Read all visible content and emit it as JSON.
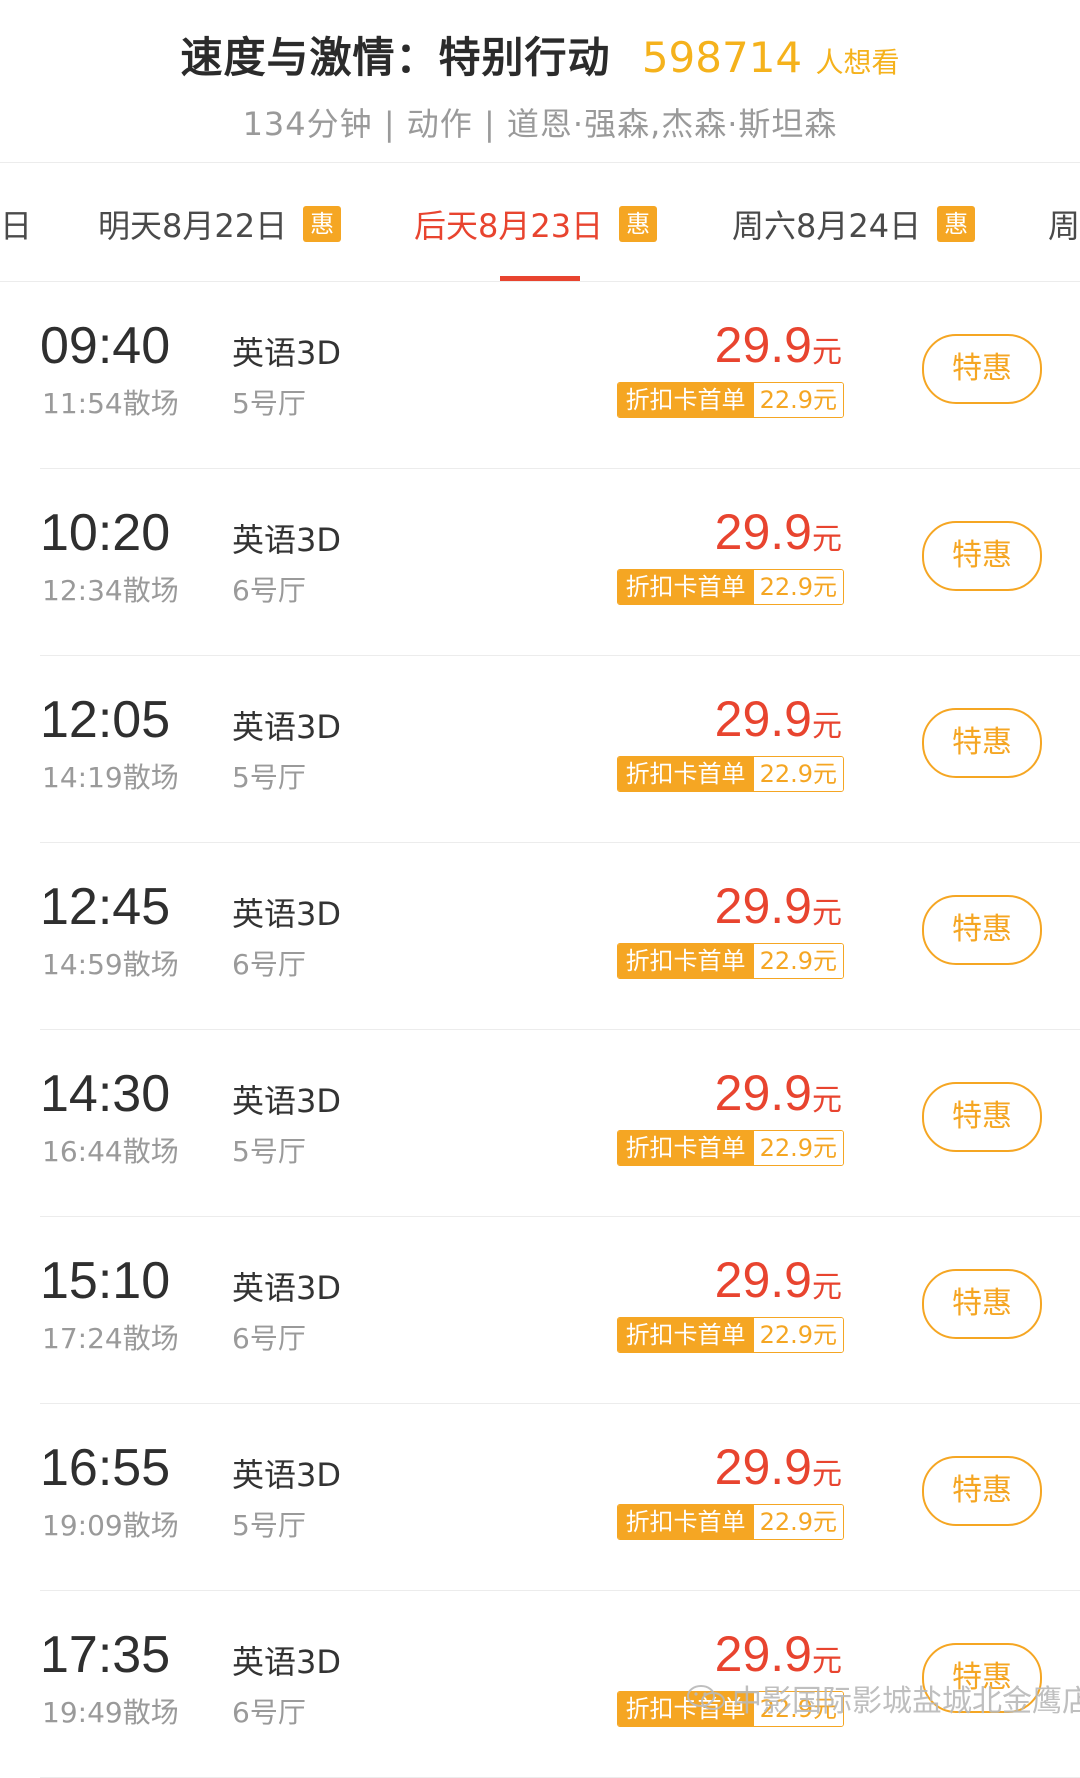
{
  "movie": {
    "title": "速度与激情：特别行动",
    "want_count": "598714",
    "want_label": "人想看",
    "info": "134分钟 | 动作 | 道恩·强森,杰森·斯坦森"
  },
  "date_tabs": [
    {
      "label": "日",
      "badge": ""
    },
    {
      "label": "明天8月22日",
      "badge": "惠"
    },
    {
      "label": "后天8月23日",
      "badge": "惠",
      "active": true
    },
    {
      "label": "周六8月24日",
      "badge": "惠"
    },
    {
      "label": "周",
      "badge": ""
    }
  ],
  "showtimes": [
    {
      "start": "09:40",
      "end": "11:54散场",
      "lang": "英语3D",
      "hall": "5号厅",
      "price": "29.9",
      "unit": "元",
      "card_label": "折扣卡首单",
      "card_price": "22.9元",
      "button": "特惠"
    },
    {
      "start": "10:20",
      "end": "12:34散场",
      "lang": "英语3D",
      "hall": "6号厅",
      "price": "29.9",
      "unit": "元",
      "card_label": "折扣卡首单",
      "card_price": "22.9元",
      "button": "特惠"
    },
    {
      "start": "12:05",
      "end": "14:19散场",
      "lang": "英语3D",
      "hall": "5号厅",
      "price": "29.9",
      "unit": "元",
      "card_label": "折扣卡首单",
      "card_price": "22.9元",
      "button": "特惠"
    },
    {
      "start": "12:45",
      "end": "14:59散场",
      "lang": "英语3D",
      "hall": "6号厅",
      "price": "29.9",
      "unit": "元",
      "card_label": "折扣卡首单",
      "card_price": "22.9元",
      "button": "特惠"
    },
    {
      "start": "14:30",
      "end": "16:44散场",
      "lang": "英语3D",
      "hall": "5号厅",
      "price": "29.9",
      "unit": "元",
      "card_label": "折扣卡首单",
      "card_price": "22.9元",
      "button": "特惠"
    },
    {
      "start": "15:10",
      "end": "17:24散场",
      "lang": "英语3D",
      "hall": "6号厅",
      "price": "29.9",
      "unit": "元",
      "card_label": "折扣卡首单",
      "card_price": "22.9元",
      "button": "特惠"
    },
    {
      "start": "16:55",
      "end": "19:09散场",
      "lang": "英语3D",
      "hall": "5号厅",
      "price": "29.9",
      "unit": "元",
      "card_label": "折扣卡首单",
      "card_price": "22.9元",
      "button": "特惠"
    },
    {
      "start": "17:35",
      "end": "19:49散场",
      "lang": "英语3D",
      "hall": "6号厅",
      "price": "29.9",
      "unit": "元",
      "card_label": "折扣卡首单",
      "card_price": "22.9元",
      "button": "特惠"
    }
  ],
  "watermark": "中影国际影城盐城北金鹰店",
  "colors": {
    "accent_red": "#e8442f",
    "accent_orange": "#f5a623",
    "want_yellow": "#f5b21c"
  }
}
